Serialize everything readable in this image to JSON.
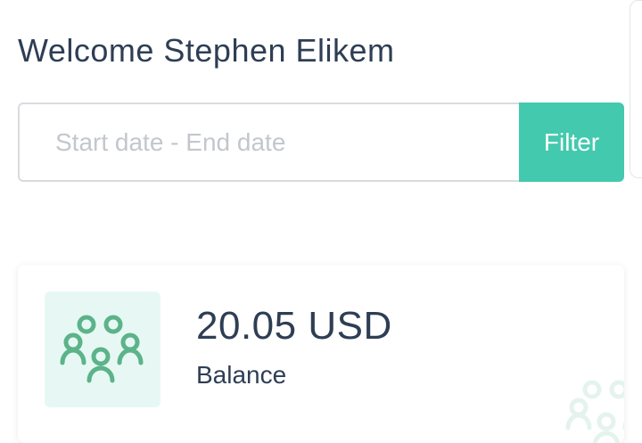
{
  "header": {
    "welcome_text": "Welcome Stephen Elikem"
  },
  "filter": {
    "date_placeholder": "Start date - End date",
    "button_label": "Filter"
  },
  "balance_card": {
    "value": "20.05 USD",
    "label": "Balance",
    "icon": "users-group-icon",
    "watermark_icon": "users-group-icon"
  },
  "colors": {
    "accent": "#43c9ae",
    "icon_bg": "#e7f8f4",
    "icon_color": "#5cb38a",
    "text": "#2e3e54"
  }
}
